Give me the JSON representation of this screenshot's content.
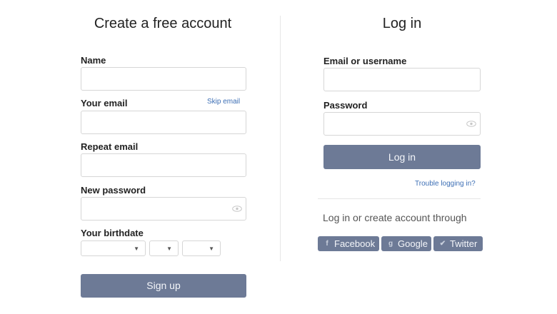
{
  "signup": {
    "title": "Create a free account",
    "name_label": "Name",
    "email_label": "Your email",
    "skip_email": "Skip email",
    "repeat_email_label": "Repeat email",
    "password_label": "New password",
    "birthdate_label": "Your birthdate",
    "day_value": "",
    "month_value": "",
    "year_value": "",
    "button": "Sign up"
  },
  "login": {
    "title": "Log in",
    "user_label": "Email or username",
    "password_label": "Password",
    "button": "Log in",
    "trouble": "Trouble logging in?",
    "through": "Log in or create account through",
    "providers": [
      {
        "label": "Facebook",
        "icon": "facebook-icon"
      },
      {
        "label": "Google",
        "icon": "google-icon"
      },
      {
        "label": "Twitter",
        "icon": "twitter-icon"
      }
    ]
  },
  "colors": {
    "button": "#6d7a96",
    "link": "#3d6fb5",
    "border": "#d6d6d6"
  }
}
